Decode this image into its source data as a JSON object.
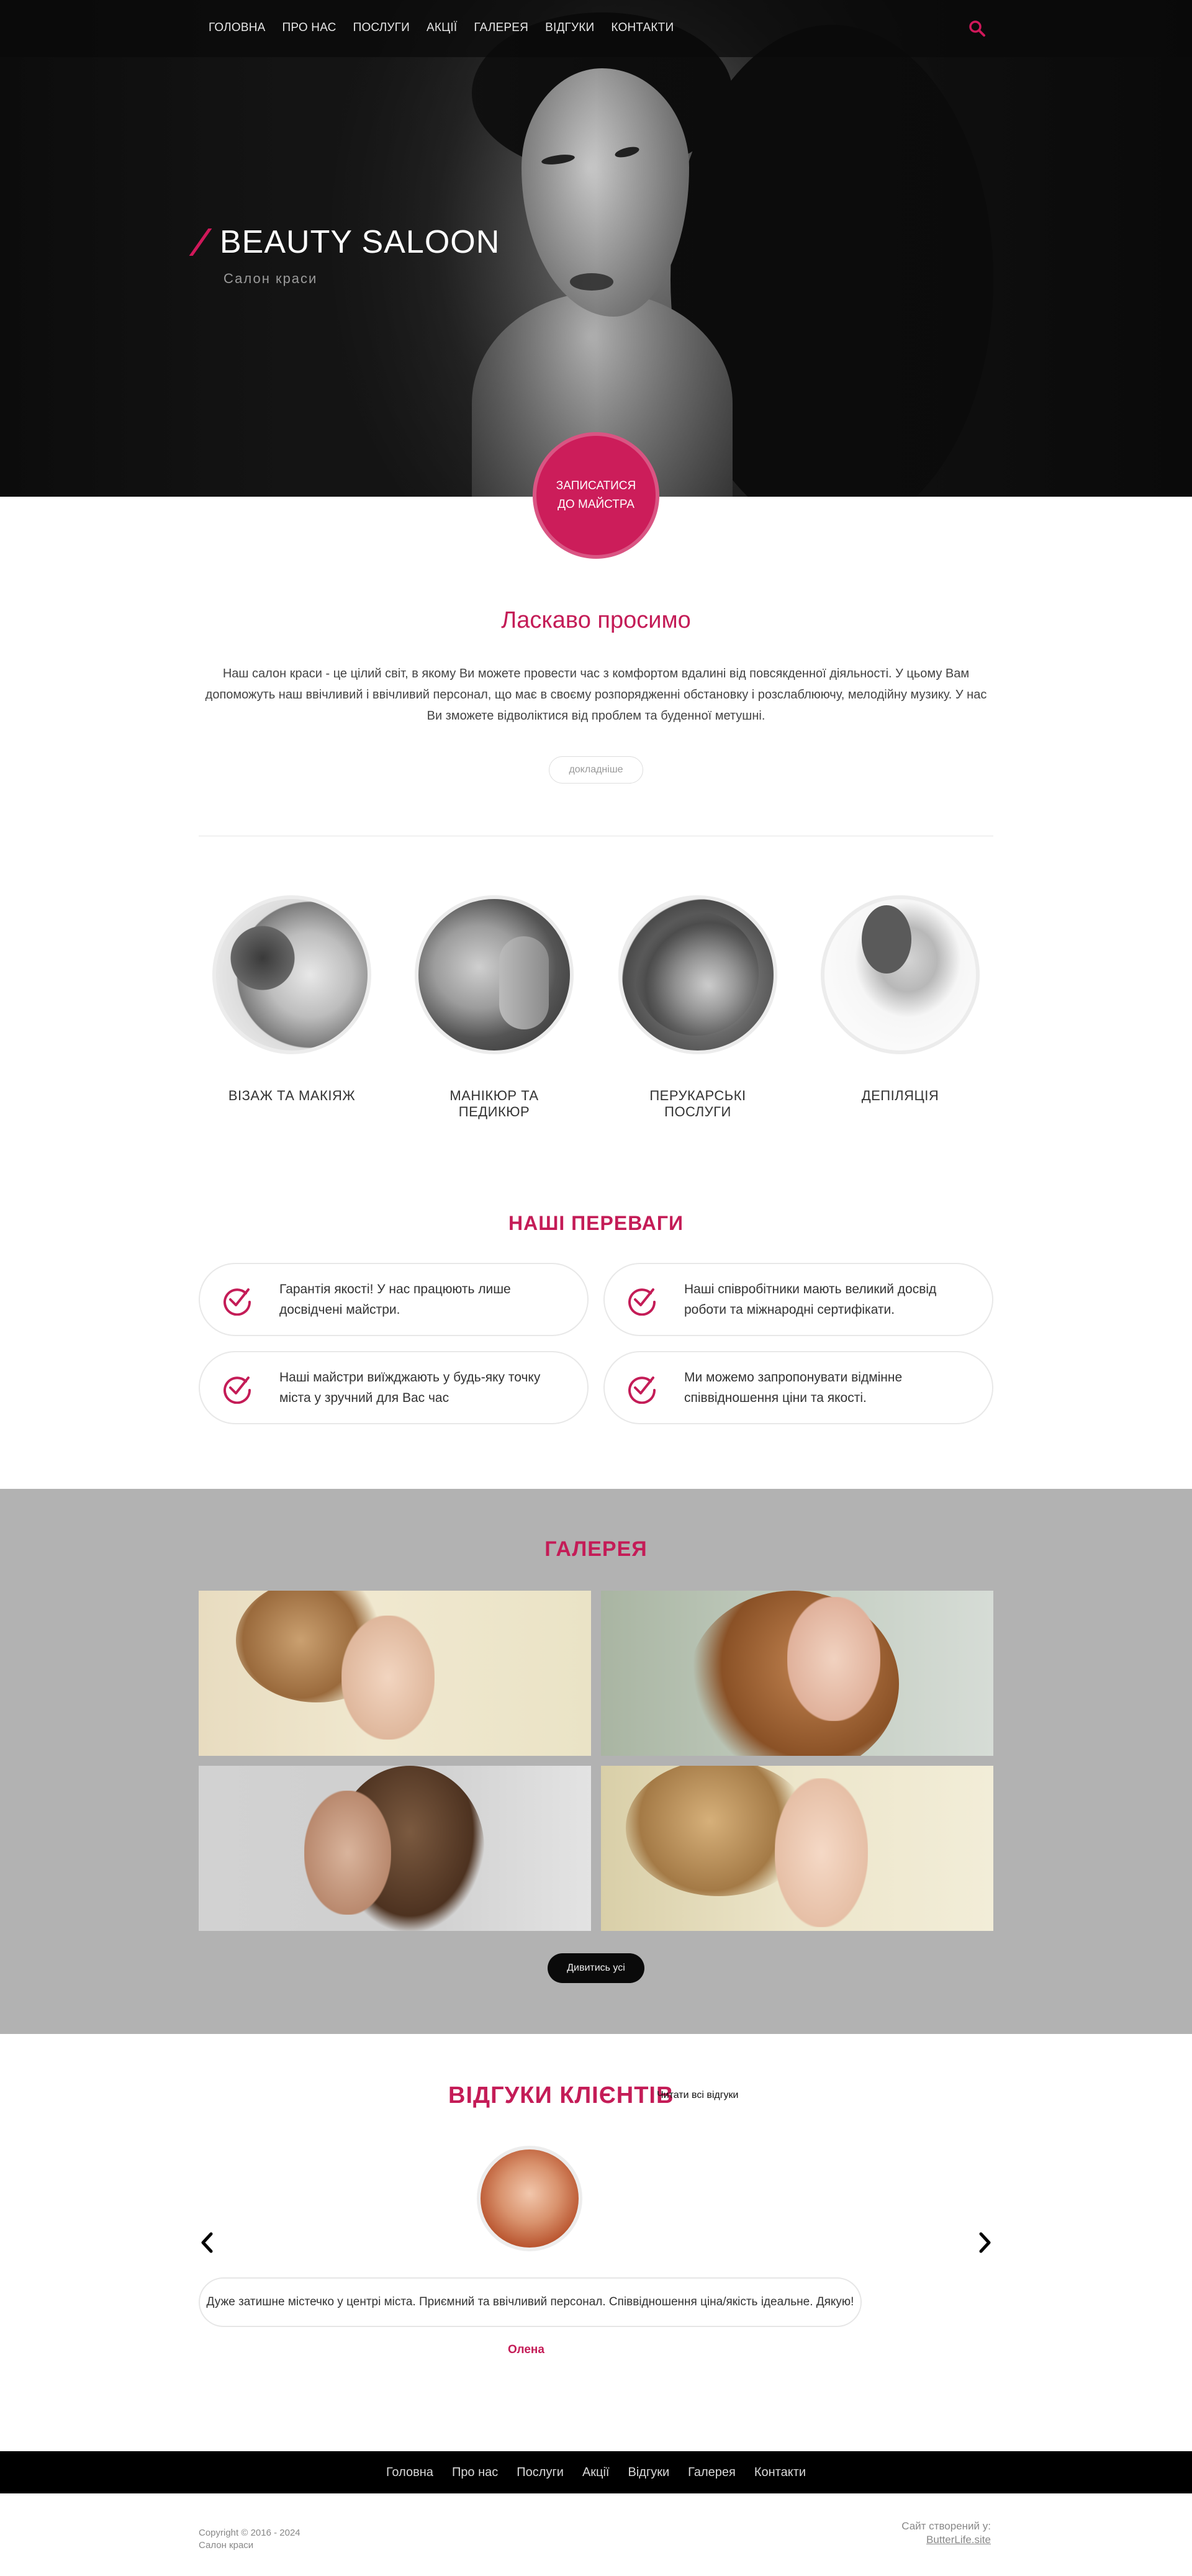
{
  "nav": {
    "items": [
      "ГОЛОВНА",
      "ПРО НАС",
      "ПОСЛУГИ",
      "АКЦІЇ",
      "ГАЛЕРЕЯ",
      "ВІДГУКИ",
      "КОНТАКТИ"
    ],
    "search_icon": "search-icon"
  },
  "hero": {
    "title": "BEAUTY SALOON",
    "subtitle": "Салон краси",
    "cta": "ЗАПИСАТИСЯ ДО МАЙСТРА"
  },
  "welcome": {
    "title": "Ласкаво просимо",
    "text": "Наш салон краси - це цілий світ, в якому Ви можете провести час з комфортом вдалині від повсякденної діяльності. У цьому Вам допоможуть наш ввічливий і ввічливий персонал, що має в своєму розпорядженні обстановку і розслаблюючу, мелодійну музику. У нас Ви зможете відволіктися від проблем та буденної метушні.",
    "more": "докладніше"
  },
  "services": [
    {
      "label": "ВІЗАЖ ТА МАКІЯЖ"
    },
    {
      "label": "МАНІКЮР ТА ПЕДИКЮР"
    },
    {
      "label": "ПЕРУКАРСЬКІ ПОСЛУГИ"
    },
    {
      "label": "ДЕПІЛЯЦІЯ"
    }
  ],
  "advantages": {
    "title": "НАШІ ПЕРЕВАГИ",
    "items": [
      {
        "line1": "Гарантія якості! У нас працюють лише",
        "line2": "досвідчені майстри."
      },
      {
        "line1": "Наші співробітники мають великий досвід",
        "line2": "роботи та міжнародні сертифікати."
      },
      {
        "line1": "Наші майстри виїжджають у будь-яку точку",
        "line2": "міста у зручний для Вас час"
      },
      {
        "line1": "Ми можемо запропонувати відмінне",
        "line2": "співвідношення ціни та якості."
      }
    ]
  },
  "gallery": {
    "title": "ГАЛЕРЕЯ",
    "see_all": "Дивитись усі"
  },
  "reviews": {
    "title": "ВІДГУКИ КЛІЄНТІВ",
    "read_all": "Читати всі відгуки",
    "text": "Дуже затишне містечко у центрі міста. Приємний та ввічливий персонал. Співвідношення ціна/якість ідеальне. Дякую!",
    "author": "Олена"
  },
  "footer": {
    "links": [
      "Головна",
      "Про нас",
      "Послуги",
      "Акції",
      "Відгуки",
      "Галерея",
      "Контакти"
    ],
    "copyright_line1": "Copyright © 2016 - 2024",
    "copyright_line2": "Салон краси",
    "creator_label": "Сайт створений у:",
    "creator_link": "ButterLife.site"
  },
  "colors": {
    "accent": "#c41c57",
    "gallery_bg": "#b2b2b2",
    "footer_bg": "#000000"
  }
}
